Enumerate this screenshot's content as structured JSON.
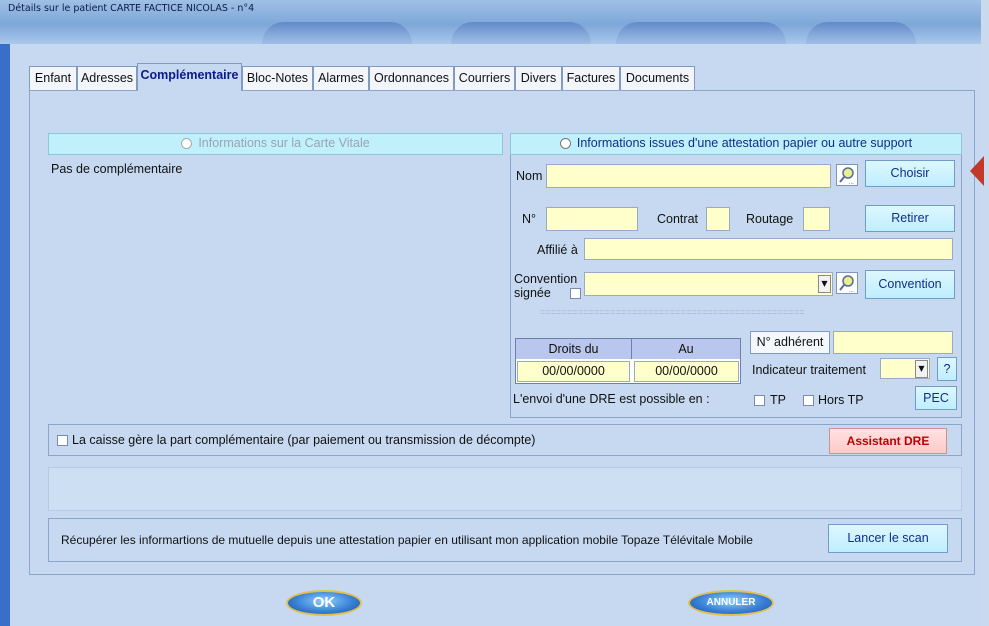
{
  "window": {
    "title": "Détails sur le patient CARTE FACTICE NICOLAS - n°4"
  },
  "tabs": [
    "Enfant",
    "Adresses",
    "Complémentaire",
    "Bloc-Notes",
    "Alarmes",
    "Ordonnances",
    "Courriers",
    "Divers",
    "Factures",
    "Documents"
  ],
  "active_tab": "Complémentaire",
  "left_panel": {
    "header": "Informations sur la Carte Vitale",
    "content": "Pas de complémentaire"
  },
  "right_panel": {
    "header": "Informations issues d'une attestation papier ou autre support",
    "nom_label": "Nom",
    "choisir_button": "Choisir",
    "numero_label": "N°",
    "contrat_label": "Contrat",
    "routage_label": "Routage",
    "retirer_button": "Retirer",
    "affilie_label": "Affilié à",
    "convention_label_line1": "Convention",
    "convention_label_line2": "signée",
    "convention_button": "Convention",
    "separator": "=================================================",
    "droits_du_header": "Droits du",
    "au_header": "Au",
    "droits_du_value": "00/00/0000",
    "au_value": "00/00/0000",
    "adherent_label": "N° adhérent",
    "indicateur_label": "Indicateur traitement",
    "help_button": "?",
    "dre_label": "L'envoi d'une DRE est possible en :",
    "tp_label": "TP",
    "hors_tp_label": "Hors TP",
    "pec_button": "PEC"
  },
  "caisse": {
    "checkbox_label": "La caisse gère la part complémentaire (par paiement ou transmission de décompte)",
    "assistant_button": "Assistant DRE"
  },
  "scan": {
    "text": "Récupérer les informartions de mutuelle depuis une attestation papier en utilisant mon application mobile Topaze Télévitale Mobile",
    "button": "Lancer le scan"
  },
  "footer": {
    "ok_button": "OK",
    "annuler_button": "ANNULER"
  },
  "colors": {
    "accent_red_text": "#c00000",
    "arrow_red": "#c0392b",
    "header_cyan": "#bff0fb",
    "input_yellow": "#ffffcc"
  },
  "icons": {
    "search": "search-icon",
    "dropdown": "chevron-down-icon"
  }
}
